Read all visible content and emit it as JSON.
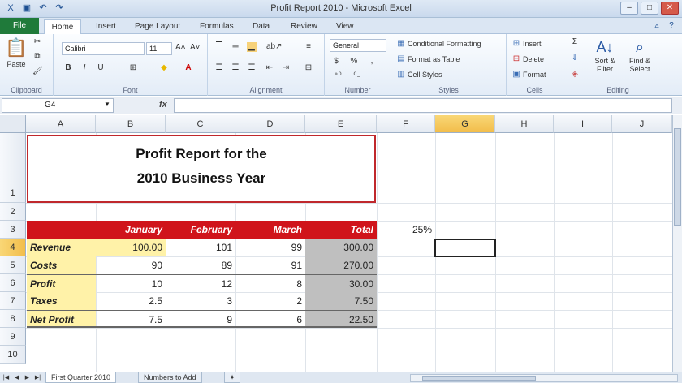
{
  "window": {
    "title": "Profit Report 2010 - Microsoft Excel",
    "controls": [
      "–",
      "□",
      "✕"
    ]
  },
  "qat_icons": [
    "excel-logo-icon",
    "save-icon",
    "undo-icon",
    "redo-icon"
  ],
  "tabs": {
    "file": "File",
    "home": "Home",
    "insert": "Insert",
    "page_layout": "Page Layout",
    "formulas": "Formulas",
    "data": "Data",
    "review": "Review",
    "view": "View"
  },
  "ribbon": {
    "clipboard": {
      "paste": "Paste",
      "label": "Clipboard"
    },
    "font": {
      "name": "Calibri",
      "size": "11",
      "label": "Font"
    },
    "alignment": {
      "label": "Alignment"
    },
    "number": {
      "format": "General",
      "currency": "$",
      "percent": "%",
      "comma": ",",
      "label": "Number"
    },
    "styles": {
      "conditional": "Conditional Formatting",
      "format_table": "Format as Table",
      "cell_styles": "Cell Styles",
      "label": "Styles"
    },
    "cells": {
      "insert": "Insert",
      "delete": "Delete",
      "format": "Format",
      "label": "Cells"
    },
    "editing": {
      "sigma": "Σ",
      "sort_filter": "Sort & Filter",
      "find_select": "Find & Select",
      "label": "Editing"
    }
  },
  "formula_bar": {
    "name_box": "G4",
    "fx": "fx",
    "value": ""
  },
  "columns": [
    "A",
    "B",
    "C",
    "D",
    "E",
    "F",
    "G",
    "H",
    "I",
    "J"
  ],
  "rows": [
    "1",
    "2",
    "3",
    "4",
    "5",
    "6",
    "7",
    "8",
    "9",
    "10"
  ],
  "selected": {
    "column": "G",
    "row": "4"
  },
  "sheet": {
    "title_line1": "Profit Report for the",
    "title_line2": "2010 Business Year",
    "header": [
      "January",
      "February",
      "March",
      "Total"
    ],
    "f3": "25%",
    "data": [
      {
        "label": "Revenue",
        "jan": "100.00",
        "feb": "101",
        "mar": "99",
        "total": "300.00"
      },
      {
        "label": "Costs",
        "jan": "90",
        "feb": "89",
        "mar": "91",
        "total": "270.00"
      },
      {
        "label": "Profit",
        "jan": "10",
        "feb": "12",
        "mar": "8",
        "total": "30.00"
      },
      {
        "label": "Taxes",
        "jan": "2.5",
        "feb": "3",
        "mar": "2",
        "total": "7.50"
      },
      {
        "label": "Net Profit",
        "jan": "7.5",
        "feb": "9",
        "mar": "6",
        "total": "22.50"
      }
    ]
  },
  "sheet_tabs": [
    "First Quarter 2010",
    "Numbers to Add"
  ],
  "colors": {
    "header_red": "#d0141b",
    "label_yellow": "#fff2a8",
    "total_gray": "#bfbfbf",
    "title_border": "#c0282c"
  }
}
